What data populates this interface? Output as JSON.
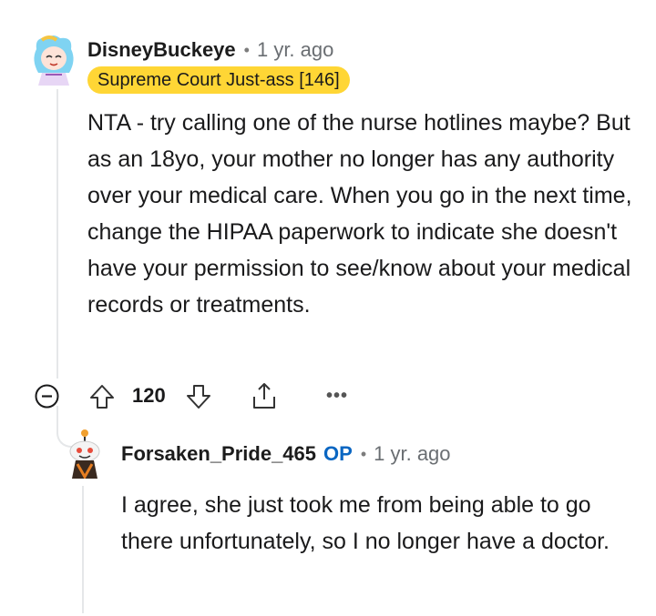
{
  "comment": {
    "author": "DisneyBuckeye",
    "time": "1 yr. ago",
    "flair": "Supreme Court Just-ass [146]",
    "text": "NTA - try calling one of the nurse hotlines maybe? But as an 18yo, your mother no longer has any authority over your medical care. When you go in the next time, change the HIPAA paperwork to indicate she doesn't have your permission to see/know about your medical records or treatments.",
    "score": "120",
    "separator": "•"
  },
  "reply": {
    "author": "Forsaken_Pride_465",
    "op_label": "OP",
    "time": "1 yr. ago",
    "text": "I agree, she just took me from being able to go there unfortunately, so I no longer have a doctor.",
    "separator": "•"
  },
  "icons": {
    "collapse": "collapse-minus-icon",
    "upvote": "upvote-arrow-icon",
    "downvote": "downvote-arrow-icon",
    "share": "share-icon",
    "more": "more-options-icon",
    "more_glyph": "•••"
  },
  "colors": {
    "flair_bg": "#ffd635",
    "op": "#0a66c2",
    "thread_line": "#e5e7e9"
  }
}
